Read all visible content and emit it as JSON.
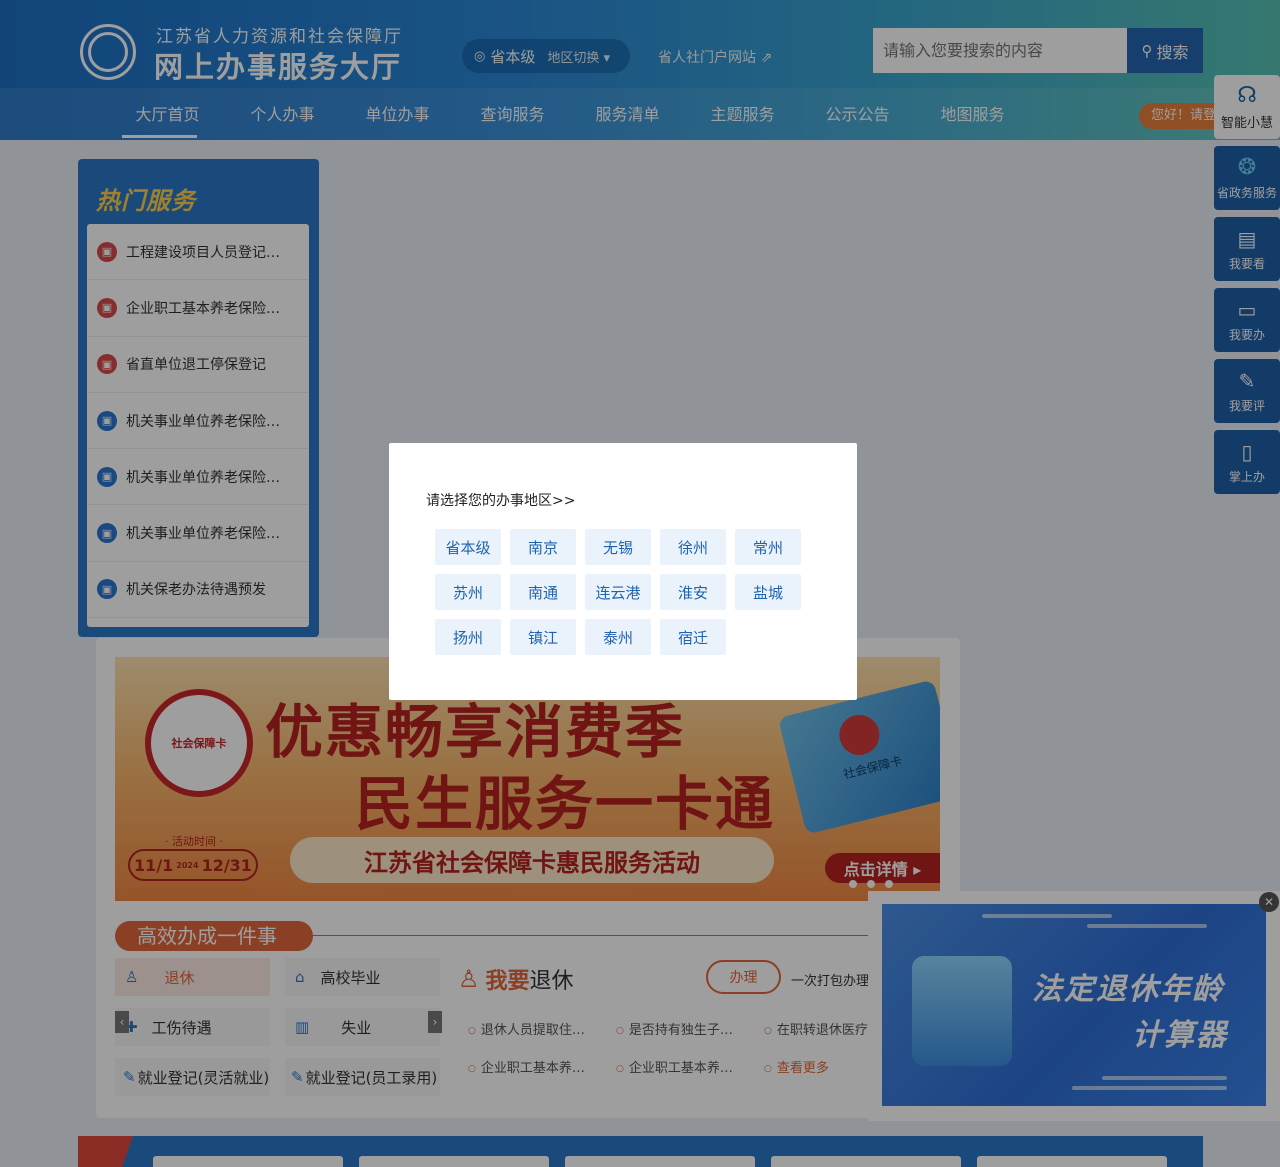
{
  "header": {
    "org_name": "江苏省人力资源和社会保障厅",
    "site_name": "网上办事服务大厅",
    "region_current": "省本级",
    "region_switch": "地区切换 ▾",
    "portal_link": "省人社门户网站 ⇗",
    "search_placeholder": "请输入您要搜索的内容",
    "search_button": "搜索",
    "greeting": "您好！请登录",
    "nav": [
      "大厅首页",
      "个人办事",
      "单位办事",
      "查询服务",
      "服务清单",
      "主题服务",
      "公示公告",
      "地图服务"
    ]
  },
  "side_tools": [
    "智能小慧",
    "省政务服务",
    "我要看",
    "我要办",
    "我要评",
    "掌上办"
  ],
  "hot_services": {
    "title": "热门服务",
    "items": [
      "工程建设项目人员登记…",
      "企业职工基本养老保险…",
      "省直单位退工停保登记",
      "机关事业单位养老保险…",
      "机关事业单位养老保险…",
      "机关事业单位养老保险…",
      "机关保老办法待遇预发"
    ]
  },
  "banner": {
    "line1": "优惠畅享消费季",
    "line2": "民生服务一卡通",
    "badge_text": "社会保障卡",
    "activity_label": "· 活动时间 ·",
    "date_start": "11/1",
    "date_year": "2024",
    "date_end": "12/31",
    "activity_name": "江苏省社会保障卡惠民服务活动",
    "card_text": "社会保障卡",
    "detail_button": "点击详情 ▸"
  },
  "one_thing": {
    "title": "高效办成一件事",
    "categories": [
      "退休",
      "高校毕业",
      "工伤待遇",
      "失业",
      "就业登记(灵活就业)",
      "就业登记(员工录用)"
    ],
    "selected_title_prefix": "我要",
    "selected_title": "退休",
    "do_button": "办理",
    "pack_text": "一次打包办理",
    "links": [
      "退休人员提取住…",
      "是否持有独生子…",
      "在职转退休医疗",
      "企业职工基本养…",
      "企业职工基本养…"
    ],
    "more": "查看更多"
  },
  "ad": {
    "line1": "法定退休年龄",
    "line2": "计算器",
    "close": "✕"
  },
  "modal": {
    "title": "请选择您的办事地区>>",
    "regions": [
      "省本级",
      "南京",
      "无锡",
      "徐州",
      "常州",
      "苏州",
      "南通",
      "连云港",
      "淮安",
      "盐城",
      "扬州",
      "镇江",
      "泰州",
      "宿迁"
    ]
  }
}
